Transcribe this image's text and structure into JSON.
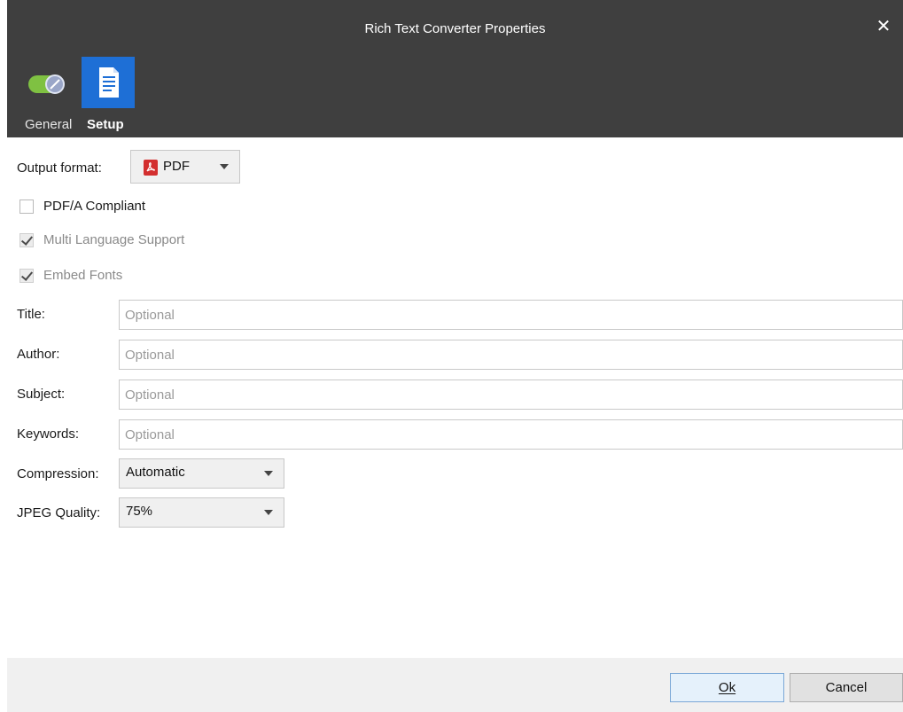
{
  "window": {
    "title": "Rich Text Converter Properties",
    "close_glyph": "✕"
  },
  "tabs": [
    {
      "label": "General",
      "icon": "toggle-switch-icon",
      "active": false
    },
    {
      "label": "Setup",
      "icon": "document-icon",
      "active": true
    }
  ],
  "output_format": {
    "label": "Output format:",
    "value": "PDF",
    "icon": "pdf-icon"
  },
  "checkboxes": [
    {
      "label": "PDF/A Compliant",
      "checked": false,
      "enabled": true
    },
    {
      "label": "Multi Language Support",
      "checked": true,
      "enabled": false
    },
    {
      "label": "Embed Fonts",
      "checked": true,
      "enabled": false
    }
  ],
  "fields": [
    {
      "label": "Title:",
      "value": "",
      "placeholder": "Optional"
    },
    {
      "label": "Author:",
      "value": "",
      "placeholder": "Optional"
    },
    {
      "label": "Subject:",
      "value": "",
      "placeholder": "Optional"
    },
    {
      "label": "Keywords:",
      "value": "",
      "placeholder": "Optional"
    }
  ],
  "compression": {
    "label": "Compression:",
    "value": "Automatic"
  },
  "jpeg_quality": {
    "label": "JPEG Quality:",
    "value": "75%"
  },
  "footer": {
    "ok_label": "Ok",
    "cancel_label": "Cancel"
  },
  "colors": {
    "header_bg": "#3f3f3f",
    "tab_active_bg": "#1e6fd6",
    "toggle_green": "#7fc142",
    "pdf_red": "#d32f2f",
    "footer_bg": "#f0f0f0"
  }
}
